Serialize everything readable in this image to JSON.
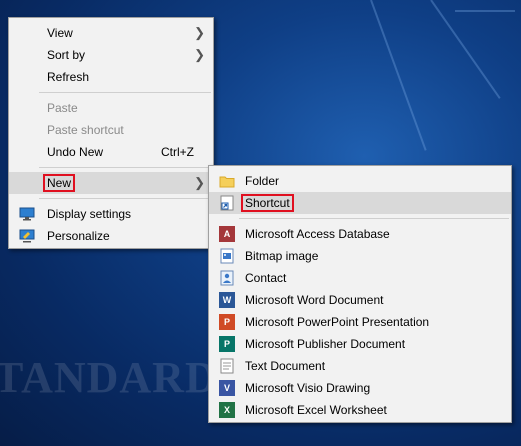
{
  "desktop": {
    "watermark": "TANDARD I"
  },
  "context_menu": {
    "items": [
      {
        "label": "View"
      },
      {
        "label": "Sort by"
      },
      {
        "label": "Refresh"
      },
      {
        "label": "Paste"
      },
      {
        "label": "Paste shortcut"
      },
      {
        "label": "Undo New",
        "shortcut": "Ctrl+Z"
      },
      {
        "label": "New"
      },
      {
        "label": "Display settings"
      },
      {
        "label": "Personalize"
      }
    ]
  },
  "new_submenu": {
    "items": [
      {
        "label": "Folder"
      },
      {
        "label": "Shortcut"
      },
      {
        "label": "Microsoft Access Database"
      },
      {
        "label": "Bitmap image"
      },
      {
        "label": "Contact"
      },
      {
        "label": "Microsoft Word Document"
      },
      {
        "label": "Microsoft PowerPoint Presentation"
      },
      {
        "label": "Microsoft Publisher Document"
      },
      {
        "label": "Text Document"
      },
      {
        "label": "Microsoft Visio Drawing"
      },
      {
        "label": "Microsoft Excel Worksheet"
      }
    ]
  },
  "colors": {
    "highlight_box": "#e01020",
    "menu_bg": "#f2f2f2",
    "hover_bg": "#d9d9d9"
  }
}
